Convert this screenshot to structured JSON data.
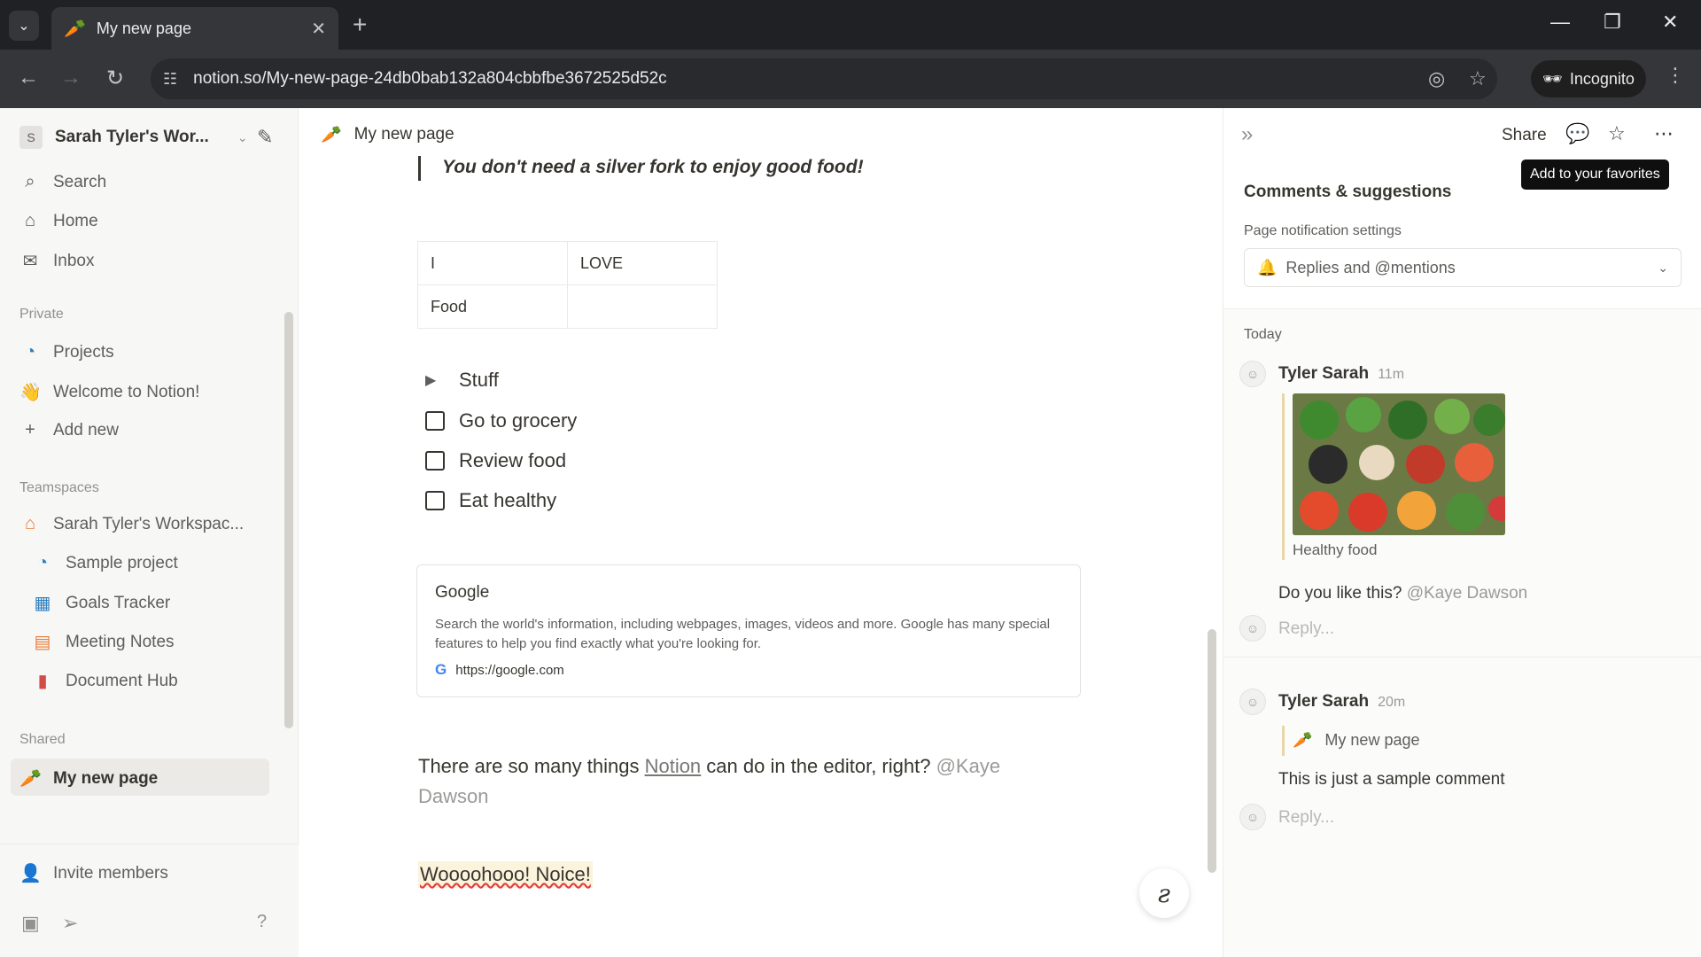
{
  "browser": {
    "tab_title": "My new page",
    "url": "notion.so/My-new-page-24db0bab132a804cbbfbe3672525d52c",
    "incognito_label": "Incognito"
  },
  "sidebar": {
    "workspace_initial": "S",
    "workspace_name": "Sarah Tyler's Wor...",
    "top_items": [
      {
        "label": "Search"
      },
      {
        "label": "Home"
      },
      {
        "label": "Inbox"
      }
    ],
    "private_header": "Private",
    "private_items": [
      {
        "label": "Projects"
      },
      {
        "label": "Welcome to Notion!"
      },
      {
        "label": "Add new"
      }
    ],
    "teamspaces_header": "Teamspaces",
    "teamspace_name": "Sarah Tyler's Workspac...",
    "teamspace_items": [
      {
        "label": "Sample project"
      },
      {
        "label": "Goals Tracker"
      },
      {
        "label": "Meeting Notes"
      },
      {
        "label": "Document Hub"
      }
    ],
    "shared_header": "Shared",
    "shared_items": [
      {
        "label": "My new page"
      }
    ],
    "invite_label": "Invite members"
  },
  "page": {
    "title": "My new page",
    "quote": "You don't need a silver fork to enjoy good food!",
    "table": [
      [
        "I",
        "LOVE"
      ],
      [
        "Food",
        ""
      ]
    ],
    "toggle_label": "Stuff",
    "todos": [
      {
        "label": "Go to grocery",
        "checked": false
      },
      {
        "label": "Review food",
        "checked": false
      },
      {
        "label": "Eat healthy",
        "checked": false
      }
    ],
    "bookmark": {
      "title": "Google",
      "description": "Search the world's information, including webpages, images, videos and more. Google has many special features to help you find exactly what you're looking for.",
      "url": "https://google.com"
    },
    "paragraph": {
      "before": "There are so many things ",
      "link": "Notion",
      "after": " can do in the editor, right? ",
      "mention": "@Kaye Dawson"
    },
    "highlight": "Woooohooo! Noice!"
  },
  "right_panel": {
    "share_label": "Share",
    "tooltip": "Add to your favorites",
    "heading": "Comments & suggestions",
    "notif_label": "Page notification settings",
    "notif_value": "Replies and @mentions",
    "today_label": "Today",
    "comments": [
      {
        "author": "Tyler Sarah",
        "time": "11m",
        "image_caption": "Healthy food",
        "text": "Do you like this? ",
        "mention": "@Kaye Dawson",
        "reply_placeholder": "Reply..."
      },
      {
        "author": "Tyler Sarah",
        "time": "20m",
        "ref_page": "My new page",
        "text": "This is just a sample comment",
        "reply_placeholder": "Reply..."
      }
    ]
  }
}
